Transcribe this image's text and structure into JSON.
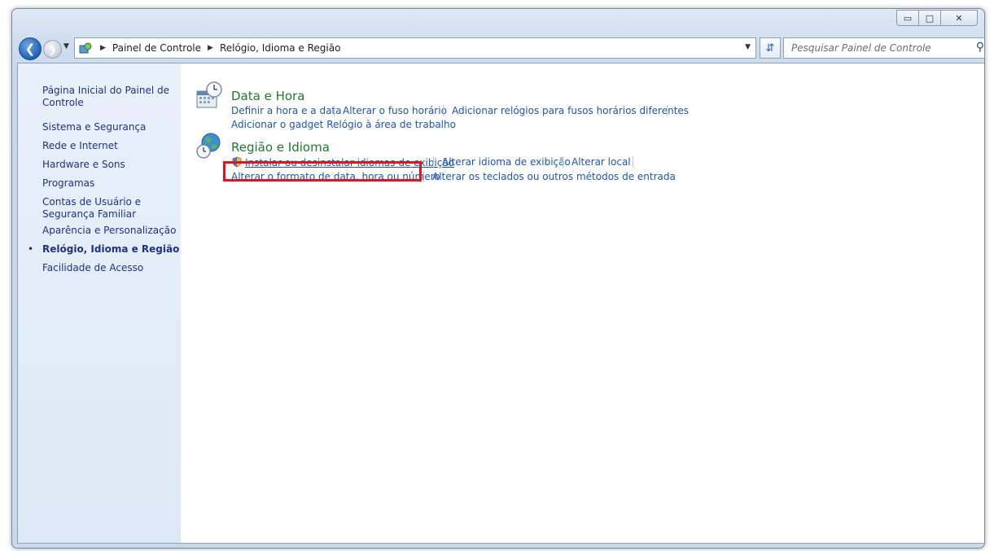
{
  "window": {
    "caption": {
      "minimize": "▭",
      "maximize": "□",
      "close": "✕"
    }
  },
  "nav": {
    "breadcrumb": [
      "Painel de Controle",
      "Relógio, Idioma e Região"
    ],
    "search_placeholder": "Pesquisar Painel de Controle"
  },
  "sidebar": {
    "items": [
      {
        "label": "Página Inicial do Painel de Controle"
      },
      {
        "label": "Sistema e Segurança"
      },
      {
        "label": "Rede e Internet"
      },
      {
        "label": "Hardware e Sons"
      },
      {
        "label": "Programas"
      },
      {
        "label": "Contas de Usuário e Segurança Familiar"
      },
      {
        "label": "Aparência e Personalização"
      },
      {
        "label": "Relógio, Idioma e Região",
        "active": true
      },
      {
        "label": "Facilidade de Acesso"
      }
    ],
    "bullet": "•"
  },
  "categories": [
    {
      "title": "Data e Hora",
      "icon": "clock-calendar-icon",
      "links": [
        "Definir a hora e a data",
        "Alterar o fuso horário",
        "Adicionar relógios para fusos horários diferentes",
        "Adicionar o gadget Relógio à área de trabalho"
      ]
    },
    {
      "title": "Região e Idioma",
      "icon": "globe-clock-icon",
      "links": [
        "Instalar ou desinstalar idiomas de exibição",
        "Alterar idioma de exibição",
        "Alterar local",
        "Alterar o formato de data, hora ou número",
        "Alterar os teclados ou outros métodos de entrada"
      ]
    }
  ],
  "colors": {
    "link": "#1a55b4",
    "category_title": "#1d7a2c",
    "highlight_box": "#e2141d"
  }
}
